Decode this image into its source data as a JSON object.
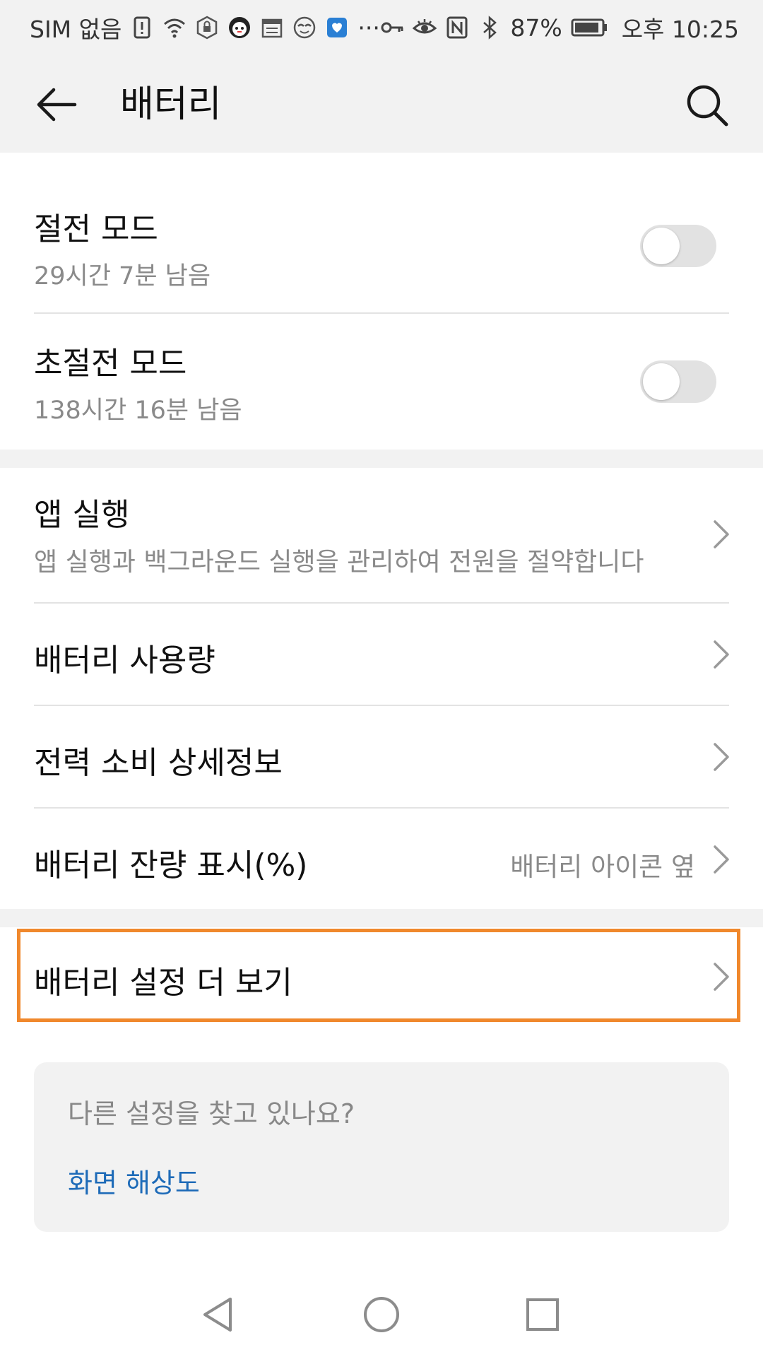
{
  "status_bar": {
    "sim_text": "SIM 없음",
    "battery_percent": "87%",
    "time": "오후 10:25",
    "more_indicator": "···",
    "icons": [
      "sim-alert-icon",
      "wifi-icon",
      "vpn-lock-icon",
      "app-notification-icon",
      "calendar-icon",
      "mask-icon",
      "chat-icon",
      "key-icon",
      "eye-icon",
      "nfc-icon",
      "bluetooth-icon",
      "battery-icon"
    ]
  },
  "app_bar": {
    "title": "배터리",
    "back_icon": "back-arrow-icon",
    "search_icon": "search-icon"
  },
  "modes": [
    {
      "title": "절전 모드",
      "subtitle": "29시간 7분 남음",
      "enabled": false
    },
    {
      "title": "초절전 모드",
      "subtitle": "138시간 16분 남음",
      "enabled": false
    }
  ],
  "menu": [
    {
      "title": "앱 실행",
      "subtitle": "앱 실행과 백그라운드 실행을 관리하여 전원을 절약합니다"
    },
    {
      "title": "배터리 사용량"
    },
    {
      "title": "전력 소비 상세정보"
    },
    {
      "title": "배터리 잔량 표시(%)",
      "value": "배터리 아이콘 옆"
    }
  ],
  "more_settings": {
    "title": "배터리 설정 더 보기",
    "highlighted": true,
    "highlight_color": "#f0882c"
  },
  "suggestion_card": {
    "question": "다른 설정을 찾고 있나요?",
    "link": "화면 해상도",
    "link_color": "#1e6bb8"
  },
  "nav_bar": {
    "icons": [
      "nav-back-icon",
      "nav-home-icon",
      "nav-recents-icon"
    ]
  }
}
